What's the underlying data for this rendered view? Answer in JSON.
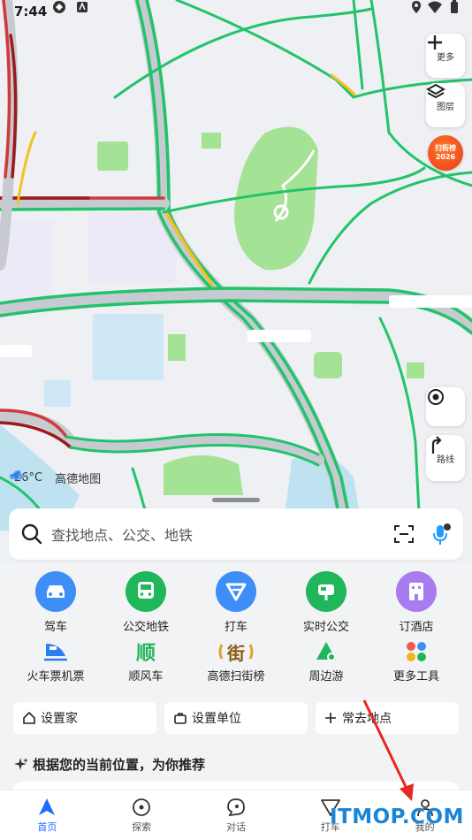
{
  "status_bar": {
    "time": "7:44"
  },
  "map": {
    "more_label": "更多",
    "layers_label": "图层",
    "street_badge": {
      "line1": "扫街榜",
      "line2": "2026"
    },
    "route_label": "路线",
    "weather": {
      "temp": "26°C",
      "brand": "高德地图"
    }
  },
  "search": {
    "placeholder": "查找地点、公交、地铁"
  },
  "primary_services": [
    {
      "label": "驾车",
      "icon": "car-icon",
      "color": "#3d8ef6"
    },
    {
      "label": "公交地铁",
      "icon": "bus-icon",
      "color": "#20b65a"
    },
    {
      "label": "打车",
      "icon": "taxi-icon",
      "color": "#3d8ef6"
    },
    {
      "label": "实时公交",
      "icon": "realtime-bus-icon",
      "color": "#20b65a"
    },
    {
      "label": "订酒店",
      "icon": "hotel-icon",
      "color": "#a77cf0"
    }
  ],
  "secondary_services": [
    {
      "label": "火车票机票",
      "icon": "train-icon"
    },
    {
      "label": "顺风车",
      "icon": "hitch-icon",
      "glyph": "顺"
    },
    {
      "label": "高德扫街榜",
      "icon": "street-ranking-icon",
      "glyph": "街"
    },
    {
      "label": "周边游",
      "icon": "nearby-travel-icon"
    },
    {
      "label": "更多工具",
      "icon": "more-tools-icon"
    }
  ],
  "quick_places": {
    "home": "设置家",
    "work": "设置单位",
    "frequent": "常去地点"
  },
  "recommend": {
    "title": "根据您的当前位置，为你推荐"
  },
  "tabs": [
    {
      "label": "首页",
      "icon": "home-nav-icon",
      "active": true
    },
    {
      "label": "探索",
      "icon": "explore-icon"
    },
    {
      "label": "对话",
      "icon": "chat-icon"
    },
    {
      "label": "打车",
      "icon": "taxi-tab-icon"
    },
    {
      "label": "我的",
      "icon": "profile-icon"
    }
  ],
  "watermark": "ITMOP.COM",
  "colors": {
    "road_green": "#22c36b",
    "road_red": "#d13a3a",
    "road_yellow": "#f4c020",
    "park_green": "#9fe28e",
    "accent_blue": "#1f6bff",
    "annotation_red": "#e8271f"
  }
}
